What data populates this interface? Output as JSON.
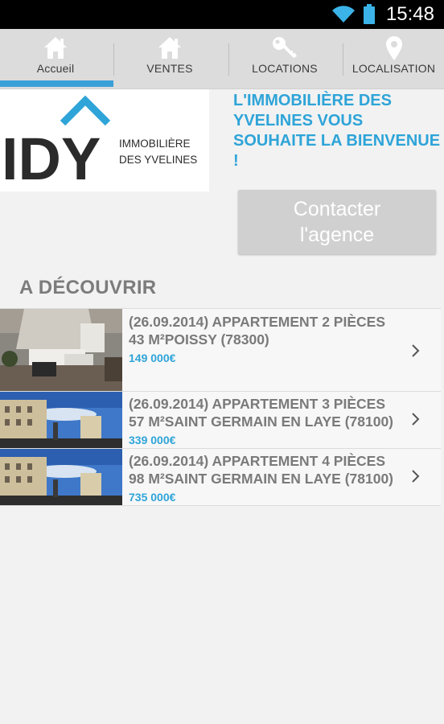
{
  "status_bar": {
    "time": "15:48"
  },
  "tabs": [
    {
      "label": "Accueil",
      "icon": "home-icon"
    },
    {
      "label": "VENTES",
      "icon": "home-icon"
    },
    {
      "label": "LOCATIONS",
      "icon": "key-icon"
    },
    {
      "label": "LOCALISATION",
      "icon": "map-pin-icon"
    }
  ],
  "logo": {
    "letters": "IDY",
    "line1": "IMMOBILIÈRE",
    "line2": "DES YVELINES"
  },
  "welcome_text": "L'IMMOBILIÈRE DES YVELINES VOUS SOUHAITE LA BIENVENUE !",
  "contact_button": "Contacter l'agence",
  "section_title": "A DÉCOUVRIR",
  "listings": [
    {
      "title": "(26.09.2014) APPARTEMENT 2 PIÈCES 43 M²POISSY (78300)",
      "price": "149 000€",
      "thumb": "apartment-interior-photo"
    },
    {
      "title": "(26.09.2014) APPARTEMENT 3 PIÈCES 57 M²SAINT GERMAIN EN LAYE (78100)",
      "price": "339 000€",
      "thumb": "building-street-photo"
    },
    {
      "title": "(26.09.2014) APPARTEMENT 4 PIÈCES 98 M²SAINT GERMAIN EN LAYE (78100)",
      "price": "735 000€",
      "thumb": "building-street-photo"
    }
  ],
  "colors": {
    "accent": "#2ea4d8",
    "tab_indicator": "#3aa0d8",
    "tab_bar": "#dcdcdc",
    "button": "#d0d0d0"
  }
}
